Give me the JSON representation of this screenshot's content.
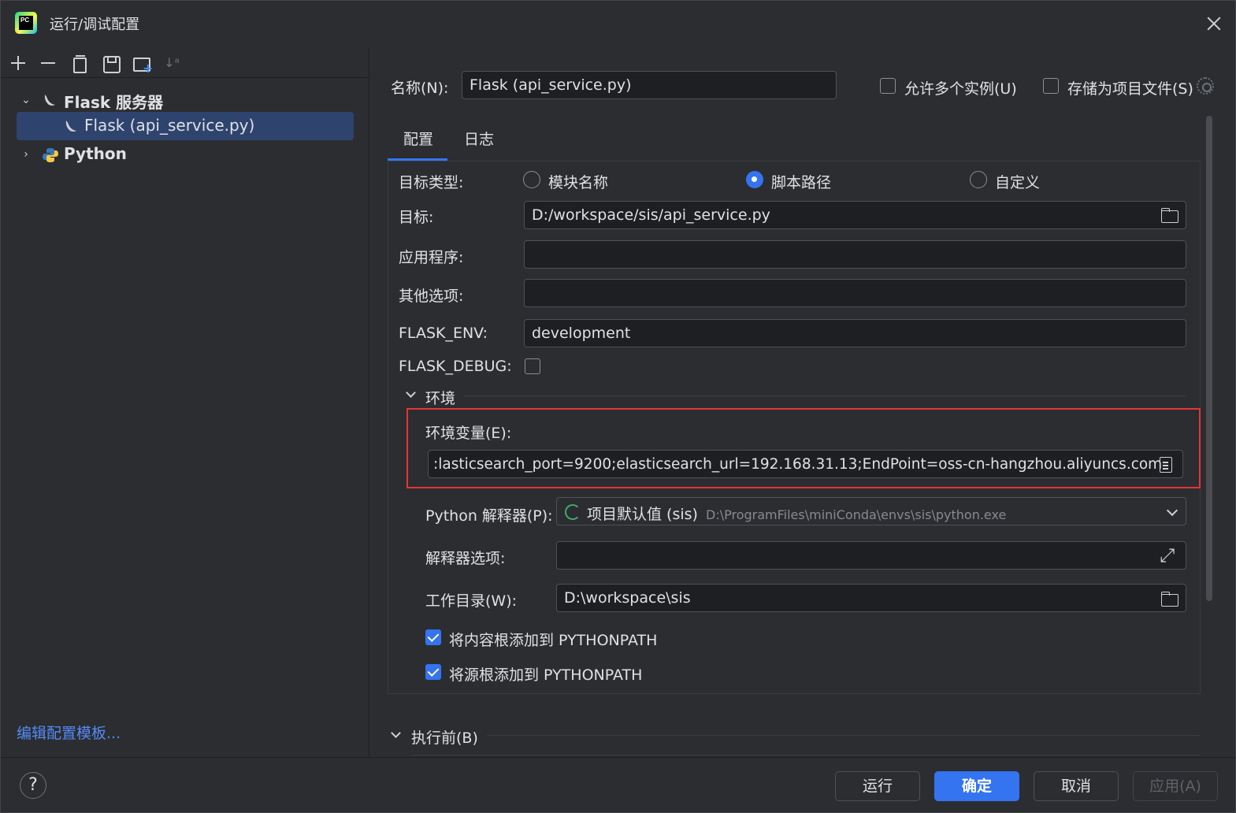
{
  "window": {
    "title": "运行/调试配置",
    "logo_text": "PC"
  },
  "tree": {
    "items": [
      {
        "label": "Flask 服务器",
        "expanded": true
      },
      {
        "label": "Flask (api_service.py)",
        "selected": true
      },
      {
        "label": "Python",
        "expanded": false
      }
    ],
    "edit_templates": "编辑配置模板..."
  },
  "header": {
    "name_label": "名称(N):",
    "name_value": "Flask (api_service.py)",
    "allow_multiple_label": "允许多个实例(U)",
    "store_as_project_label": "存储为项目文件(S)"
  },
  "tabs": [
    {
      "label": "配置",
      "active": true
    },
    {
      "label": "日志",
      "active": false
    }
  ],
  "config": {
    "target_type_label": "目标类型:",
    "target_type_options": [
      {
        "label": "模块名称",
        "checked": false
      },
      {
        "label": "脚本路径",
        "checked": true
      },
      {
        "label": "自定义",
        "checked": false
      }
    ],
    "target_label": "目标:",
    "target_value": "D:/workspace/sis/api_service.py",
    "app_label": "应用程序:",
    "app_value": "",
    "other_options_label": "其他选项:",
    "other_options_value": "",
    "flask_env_label": "FLASK_ENV:",
    "flask_env_value": "development",
    "flask_debug_label": "FLASK_DEBUG:",
    "flask_debug_checked": false
  },
  "environment": {
    "section_label": "环境",
    "env_vars_label": "环境变量(E):",
    "env_vars_value": ":lasticsearch_port=9200;elasticsearch_url=192.168.31.13;EndPoint=oss-cn-hangzhou.aliyuncs.com",
    "interpreter_label": "Python 解释器(P):",
    "interpreter_name": "项目默认值 (sis)",
    "interpreter_path": "D:\\ProgramFiles\\miniConda\\envs\\sis\\python.exe",
    "interpreter_options_label": "解释器选项:",
    "interpreter_options_value": "",
    "workdir_label": "工作目录(W):",
    "workdir_value": "D:\\workspace\\sis",
    "add_content_roots_label": "将内容根添加到 PYTHONPATH",
    "add_content_roots_checked": true,
    "add_source_roots_label": "将源根添加到 PYTHONPATH",
    "add_source_roots_checked": true
  },
  "before_launch": {
    "label": "执行前(B)"
  },
  "buttons": {
    "help": "?",
    "run": "运行",
    "ok": "确定",
    "cancel": "取消",
    "apply": "应用(A)"
  },
  "colors": {
    "accent": "#3574f0",
    "highlight_border": "#e53535",
    "link": "#548af7",
    "selection": "#2e436e"
  }
}
